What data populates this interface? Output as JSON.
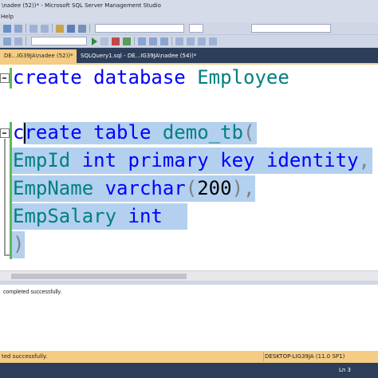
{
  "window": {
    "title": "\\nadee (52))* - Microsoft SQL Server Management Studio"
  },
  "menu": {
    "help_label": "Help"
  },
  "tabs": [
    {
      "label": "DE...IG39JA\\nadee (52))*"
    },
    {
      "label": "SQLQuery1.sql - DE...IG39JA\\nadee (54))*"
    }
  ],
  "editor": {
    "line1": {
      "kw1": "create",
      "kw2": "database",
      "ident": "Employee"
    },
    "line3": {
      "kw1": "create",
      "kw2": "table",
      "ident": "demo_tb",
      "paren": "("
    },
    "line4": {
      "ident": "EmpId",
      "kw1": "int",
      "kw2": "primary",
      "kw3": "key",
      "kw4": "identity",
      "comma": ","
    },
    "line5": {
      "ident": "EmpName",
      "kw1": "varchar",
      "open": "(",
      "num": "200",
      "close": ")",
      "comma": ","
    },
    "line6": {
      "ident": "EmpSalary",
      "kw1": "int"
    },
    "line7": {
      "paren": ")"
    }
  },
  "messages": {
    "text": "completed successfully."
  },
  "status": {
    "left": "ted successfully.",
    "server": "DESKTOP-LIG39JA (11.0 SP1)",
    "line": "Ln 3"
  },
  "colors": {
    "keyword": "#0000ff",
    "identifier": "#008080",
    "selection": "#b3d0ef",
    "active_tab": "#f5cc84",
    "dark_chrome": "#2d3e5a"
  }
}
